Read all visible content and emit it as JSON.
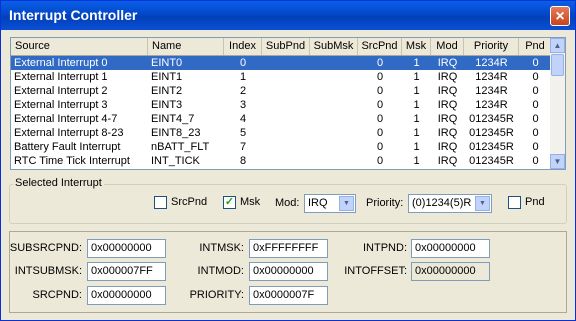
{
  "window": {
    "title": "Interrupt Controller"
  },
  "list": {
    "columns": [
      "Source",
      "Name",
      "Index",
      "SubPnd",
      "SubMsk",
      "SrcPnd",
      "Msk",
      "Mod",
      "Priority",
      "Pnd"
    ],
    "rows": [
      [
        "External Interrupt 0",
        "EINT0",
        "0",
        "",
        "",
        "0",
        "1",
        "IRQ",
        "1234R",
        "0"
      ],
      [
        "External Interrupt 1",
        "EINT1",
        "1",
        "",
        "",
        "0",
        "1",
        "IRQ",
        "1234R",
        "0"
      ],
      [
        "External Interrupt 2",
        "EINT2",
        "2",
        "",
        "",
        "0",
        "1",
        "IRQ",
        "1234R",
        "0"
      ],
      [
        "External Interrupt 3",
        "EINT3",
        "3",
        "",
        "",
        "0",
        "1",
        "IRQ",
        "1234R",
        "0"
      ],
      [
        "External Interrupt 4-7",
        "EINT4_7",
        "4",
        "",
        "",
        "0",
        "1",
        "IRQ",
        "012345R",
        "0"
      ],
      [
        "External Interrupt 8-23",
        "EINT8_23",
        "5",
        "",
        "",
        "0",
        "1",
        "IRQ",
        "012345R",
        "0"
      ],
      [
        "Battery Fault Interrupt",
        "nBATT_FLT",
        "7",
        "",
        "",
        "0",
        "1",
        "IRQ",
        "012345R",
        "0"
      ],
      [
        "RTC Time Tick Interrupt",
        "INT_TICK",
        "8",
        "",
        "",
        "0",
        "1",
        "IRQ",
        "012345R",
        "0"
      ]
    ],
    "selected_index": 0
  },
  "selected": {
    "group_label": "Selected Interrupt",
    "srcpnd_label": "SrcPnd",
    "srcpnd_checked": false,
    "msk_label": "Msk",
    "msk_checked": true,
    "mod_label": "Mod:",
    "mod_value": "IRQ",
    "priority_label": "Priority:",
    "priority_value": "(0)1234(5)R",
    "pnd_label": "Pnd",
    "pnd_checked": false
  },
  "registers": {
    "subsrcpnd": {
      "label": "SUBSRCPND:",
      "value": "0x00000000"
    },
    "intsubmsk": {
      "label": "INTSUBMSK:",
      "value": "0x000007FF"
    },
    "srcpnd": {
      "label": "SRCPND:",
      "value": "0x00000000"
    },
    "intmsk": {
      "label": "INTMSK:",
      "value": "0xFFFFFFFF"
    },
    "intmod": {
      "label": "INTMOD:",
      "value": "0x00000000"
    },
    "priority": {
      "label": "PRIORITY:",
      "value": "0x0000007F"
    },
    "intpnd": {
      "label": "INTPND:",
      "value": "0x00000000"
    },
    "intoffset": {
      "label": "INTOFFSET:",
      "value": "0x00000000"
    }
  }
}
